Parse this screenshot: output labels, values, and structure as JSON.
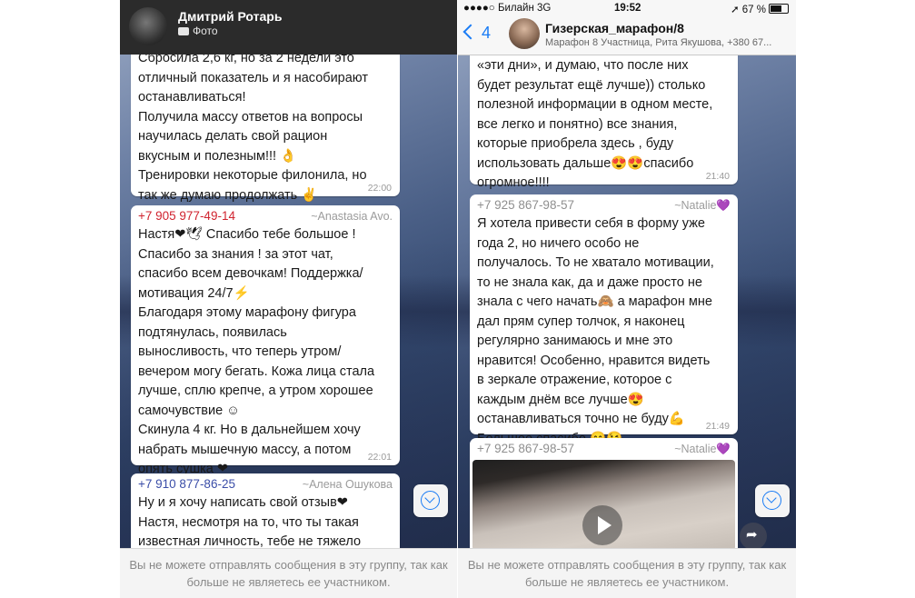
{
  "left": {
    "header": {
      "contact_name": "Дмитрий Ротарь",
      "status": "Фото"
    },
    "messages": [
      {
        "lines": [
          "Сбросила 2,6 кг, но за 2 недели это",
          "отличный показатель и я насобирают",
          "останавливаться!",
          "Получила массу ответов на вопросы",
          "научилась делать свой рацион",
          "вкусным и полезным!!! 👌",
          "Тренировки некоторые филонила, но",
          "так же думаю продолжать ✌"
        ],
        "time": "22:00"
      },
      {
        "sender": "+7 905 977-49-14",
        "alias": "~Anastasia Avo.",
        "lines": [
          "Настя❤🕊 Спасибо тебе большое !",
          "Спасибо за знания ! за этот чат,",
          "спасибо всем девочкам! Поддержка/",
          "мотивация 24/7⚡",
          "Благодаря этому марафону фигура",
          "подтянулась, появилась",
          "выносливость, что теперь утром/",
          "вечером могу бегать. Кожа лица стала",
          "лучше, сплю крепче, а утром хорошее",
          "самочувствие ☺",
          "Скинула 4 кг. Но в дальнейшем хочу",
          "набрать мышечную массу, а потом",
          "опять сушка ❤"
        ],
        "time": "22:01"
      },
      {
        "sender": "+7 910 877-86-25",
        "alias": "~Алена Ошукова",
        "lines": [
          "Ну и я хочу написать свой отзыв❤",
          "Настя, несмотря на то, что ты такая",
          "известная личность, тебе не тяжело"
        ]
      }
    ],
    "footer": "Вы не можете отправлять сообщения в эту группу, так как больше не являетесь ее участником."
  },
  "right": {
    "status_bar": {
      "carrier": "Билайн",
      "network": "3G",
      "time": "19:52",
      "battery": "67 %"
    },
    "header": {
      "back_count": "4",
      "title": "Гизерская_марафон/8",
      "subtitle": "Марафон 8 Участница, Рита Якушова, +380 67..."
    },
    "messages": [
      {
        "lines": [
          "«эти дни», и думаю, что после них",
          "будет результат ещё лучше)) столько",
          "полезной информации в одном месте,",
          "все легко и понятно) все знания,",
          "которые приобрела здесь , буду",
          "использовать дальше😍😍спасибо",
          "огромное!!!!"
        ],
        "time": "21:40"
      },
      {
        "sender": "+7 925 867-98-57",
        "alias": "~Natalie💜",
        "lines": [
          "Я хотела привести себя в форму уже",
          "года 2, но ничего особо не",
          "получалось. То не хватало мотивации,",
          "то не знала как, да и даже просто не",
          "знала с чего начать🙈 а марафон мне",
          "дал прям супер толчок, я наконец",
          "регулярно занимаюсь и мне это",
          "нравится! Особенно, нравится видеть",
          "в зеркале отражение, которое с",
          "каждым днём все лучше😍",
          "останавливаться точно не буду💪",
          "Большое спасибо 😊😘"
        ],
        "time": "21:49"
      },
      {
        "sender": "+7 925 867-98-57",
        "alias": "~Natalie💜",
        "media": "video"
      }
    ],
    "footer": "Вы не можете отправлять сообщения в эту группу, так как больше не являетесь ее участником."
  },
  "colors": {
    "sender_red": "#d0232f",
    "sender_blue": "#3b4ea8",
    "sender_gray": "#8f8f8f",
    "ios_blue": "#1a7cf5"
  },
  "icons": [
    "camera-icon",
    "scroll-down-icon",
    "forward-icon",
    "play-icon",
    "back-chevron-icon",
    "battery-icon"
  ]
}
